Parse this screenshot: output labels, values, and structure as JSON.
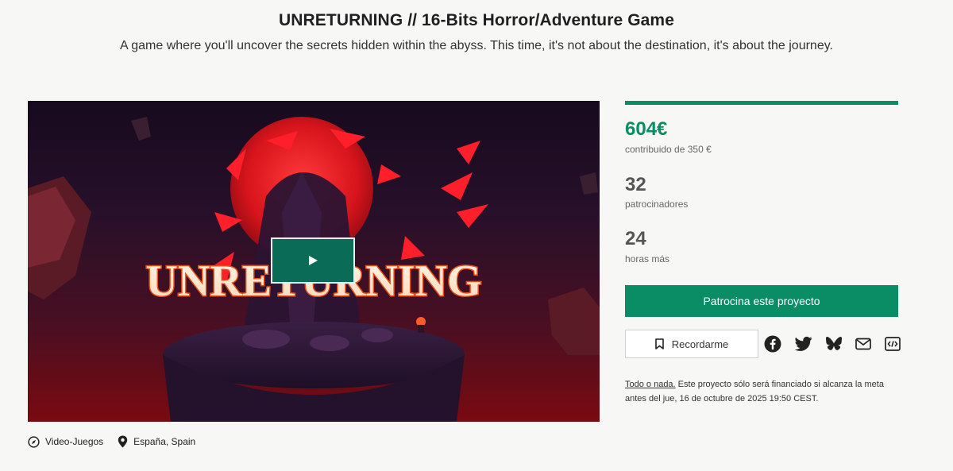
{
  "project": {
    "title": "UNRETURNING // 16-Bits Horror/Adventure Game",
    "subtitle": "A game where you'll uncover the secrets hidden within the abyss. This time, it's not about the destination, it's about the journey."
  },
  "video": {
    "logo_text": "UNRETURNING",
    "play_icon": "play-icon"
  },
  "meta": {
    "category": "Video-Juegos",
    "location": "España, Spain",
    "category_icon": "compass-icon",
    "location_icon": "map-pin-icon"
  },
  "funding": {
    "progress_fraction": 1.0,
    "amount": "604€",
    "amount_label": "contribuido de 350 €",
    "backers": "32",
    "backers_label": "patrocinadores",
    "hours": "24",
    "hours_label": "horas más"
  },
  "actions": {
    "back_label": "Patrocina este proyecto",
    "remind_label": "Recordarme",
    "share_icons": [
      "facebook-icon",
      "twitter-icon",
      "bluesky-icon",
      "email-icon",
      "embed-icon"
    ]
  },
  "note": {
    "link": "Todo o nada.",
    "text": " Este proyecto sólo será financiado si alcanza la meta antes del jue, 16 de octubre de 2025 19:50 CEST."
  },
  "colors": {
    "accent": "#0a8d64",
    "play_button": "#0a6b57",
    "background": "#f7f7f5"
  }
}
